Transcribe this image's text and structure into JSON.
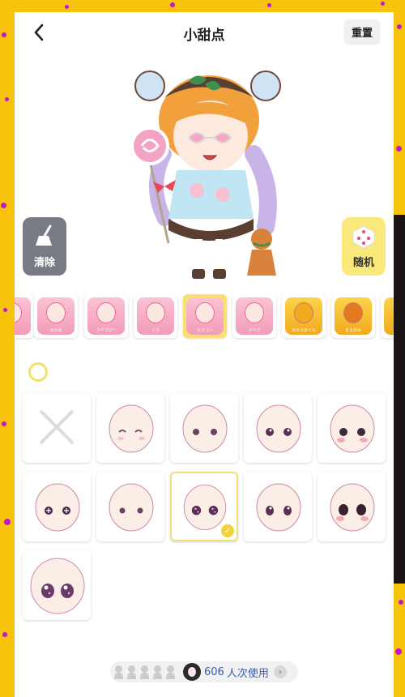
{
  "header": {
    "title": "小甜点",
    "reset_label": "重置"
  },
  "tools": {
    "clear_label": "清除",
    "random_label": "随机"
  },
  "categories": [
    {
      "label": "",
      "type": "face"
    },
    {
      "label": "みかお",
      "type": "face"
    },
    {
      "label": "フイブロー",
      "type": "face"
    },
    {
      "label": "くち",
      "type": "face"
    },
    {
      "label": "ホラコン",
      "type": "face",
      "selected": true
    },
    {
      "label": "メイク",
      "type": "face"
    },
    {
      "label": "ボヌスタイル",
      "type": "hair"
    },
    {
      "label": "まえがみ",
      "type": "hair"
    },
    {
      "label": "",
      "type": "hair"
    }
  ],
  "options": [
    {
      "kind": "none"
    },
    {
      "kind": "face",
      "eyes": "closed-heart"
    },
    {
      "kind": "face",
      "eyes": "round"
    },
    {
      "kind": "face",
      "eyes": "sparkle"
    },
    {
      "kind": "face",
      "eyes": "dark-blush"
    },
    {
      "kind": "face",
      "eyes": "plus"
    },
    {
      "kind": "face",
      "eyes": "small"
    },
    {
      "kind": "face",
      "eyes": "galaxy",
      "selected": true
    },
    {
      "kind": "face",
      "eyes": "large"
    },
    {
      "kind": "face",
      "eyes": "anime"
    },
    {
      "kind": "face",
      "eyes": "big-galaxy",
      "large": true
    }
  ],
  "footer": {
    "count": "606",
    "count_label": "人次使用"
  },
  "colors": {
    "accent": "#f7c30a",
    "selected": "#f3d238",
    "clear_bg": "#777c84",
    "random_bg": "#fae97a"
  }
}
